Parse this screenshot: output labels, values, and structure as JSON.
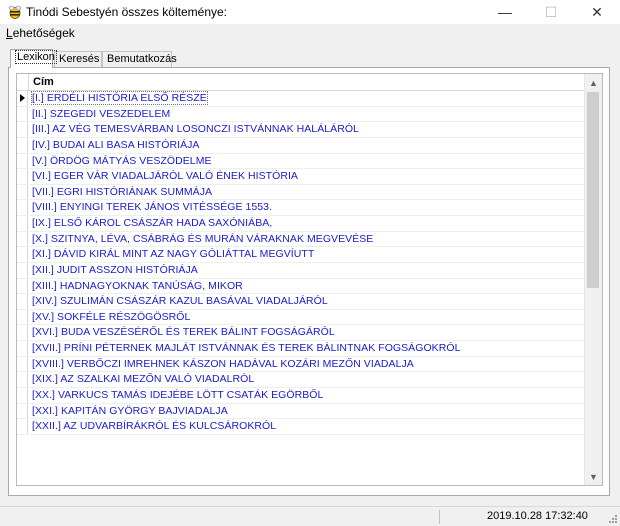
{
  "window": {
    "title": "Tinódi Sebestyén összes költeménye:",
    "icon": "bee-icon",
    "controls": {
      "minimize": "—",
      "maximize": "☐",
      "close": "✕"
    }
  },
  "menu": {
    "items": [
      {
        "label": "Lehetőségek",
        "mnemonic": "L",
        "rest": "ehetőségek"
      }
    ]
  },
  "tabs": [
    {
      "label": "Lexikon",
      "active": true
    },
    {
      "label": "Keresés",
      "active": false
    },
    {
      "label": "Bemutatkozás",
      "active": false
    }
  ],
  "grid": {
    "column_header": "Cím",
    "rows": [
      "[I.] ERDÉLI HISTÓRIA ELSŐ RÉSZE",
      "[II.] SZEGEDI VESZEDELEM",
      "[III.] AZ VÉG TEMESVÁRBAN LOSONCZI ISTVÁNNAK HALÁLÁRÓL",
      "[IV.] BUDAI ALI BASA HISTÓRIÁJA",
      "[V.] ÖRDÖG MÁTYÁS VESZÖDELME",
      "[VI.] EGER VÁR VIADALJÁRÓL VALÓ ÉNEK HISTÓRIA",
      "[VII.] EGRI HISTÓRIÁNAK SUMMÁJA",
      "[VIII.] ENYINGI TEREK JÁNOS VITÉSSÉGE 1553.",
      "[IX.] ELSŐ KÁROL CSÁSZÁR HADA SAXÓNIÁBA,",
      "[X.] SZITNYA, LÉVA, CSÁBRÁG ÉS MURÁN VÁRAKNAK MEGVEVÉSE",
      "[XI.] DÁVID KIRÁL MINT AZ NAGY GÓLIÁTTAL MEGVÍUTT",
      "[XII.] JUDIT ASSZON HISTÓRIÁJA",
      "[XIII.] HADNAGYOKNAK TANÚSÁG, MIKOR",
      "[XIV.] SZULIMÁN CSÁSZÁR KAZUL BASÁVAL VIADALJÁRÓL",
      "[XV.] SOKFÉLE RÉSZÖGÖSRŐL",
      "[XVI.] BUDA VESZÉSÉRŐL ÉS TEREK BÁLINT FOGSÁGÁRÓL",
      "[XVII.] PRÍNI PÉTERNEK MAJLÁT ISTVÁNNAK ÉS TEREK BÁLINTNAK FOGSÁGOKRÓL",
      "[XVIII.] VERBŐCZI IMREHNEK KÁSZON HADÁVAL KOZÁRI MEZŐN VIADALJA",
      "[XIX.] AZ SZALKAI MEZŐN VALÓ VIADALRÓL",
      "[XX.] VARKUCS TAMÁS IDEJÉBE LÖTT CSATÁK EGÖRBŐL",
      "[XXI.] KAPITÁN GYÖRGY BAJVIADALJA",
      "[XXII.] AZ UDVARBÍRÁKRÓL ÉS KULCSÁROKRÓL"
    ],
    "selected_index": 0
  },
  "status": {
    "datetime": "2019.10.28 17:32:40"
  },
  "colors": {
    "row_text": "#1a1acf",
    "background": "#f0f0f0"
  }
}
